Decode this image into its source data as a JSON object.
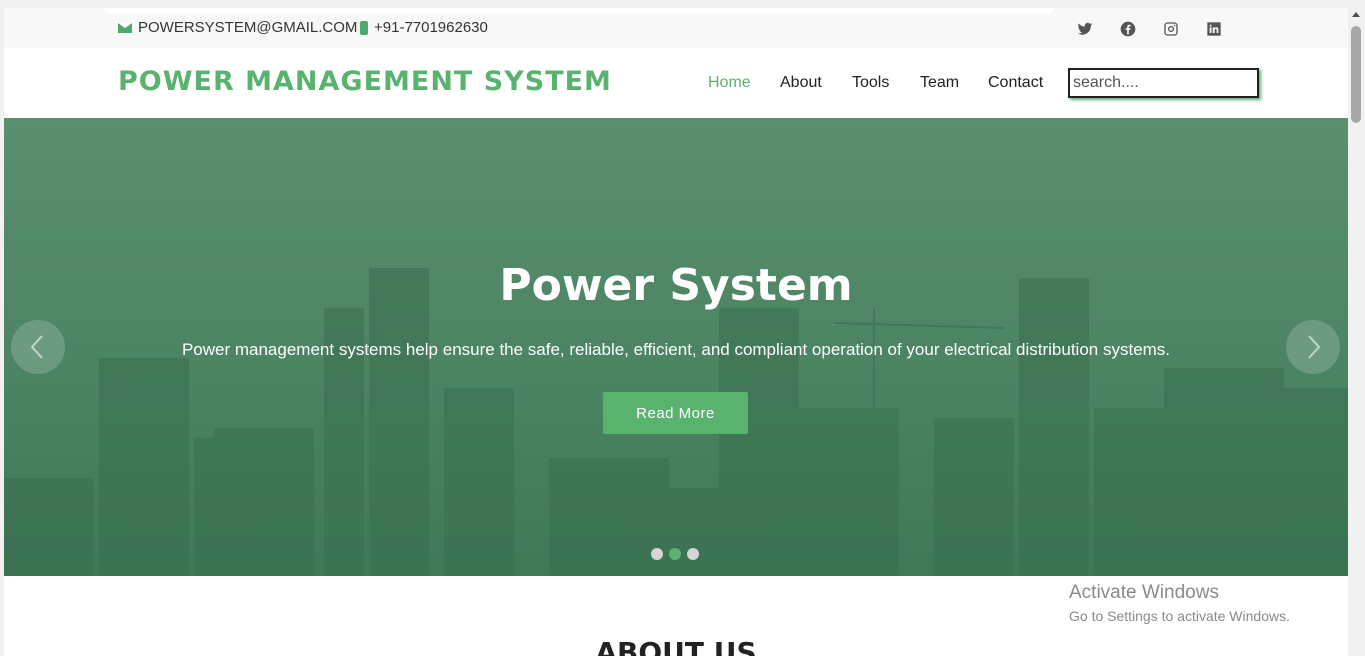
{
  "topbar": {
    "email": "POWERSYSTEM@GMAIL.COM",
    "phone": "+91-7701962630",
    "social_icons": [
      "twitter-icon",
      "facebook-icon",
      "instagram-icon",
      "linkedin-icon"
    ]
  },
  "header": {
    "logo": "POWER MANAGEMENT SYSTEM",
    "nav": [
      "Home",
      "About",
      "Tools",
      "Team",
      "Contact"
    ],
    "active_nav": "Home",
    "search_placeholder": "search...."
  },
  "hero": {
    "title": "Power System",
    "text": "Power management systems help ensure the safe, reliable, efficient, and compliant operation of your electrical distribution systems.",
    "button": "Read More",
    "slide_count": 3,
    "active_slide": 2
  },
  "about": {
    "title": "ABOUT US"
  },
  "overlay": {
    "line1": "Activate Windows",
    "line2": "Go to Settings to activate Windows."
  },
  "colors": {
    "accent": "#5ab26f",
    "hero_overlay": "#4a8362"
  }
}
